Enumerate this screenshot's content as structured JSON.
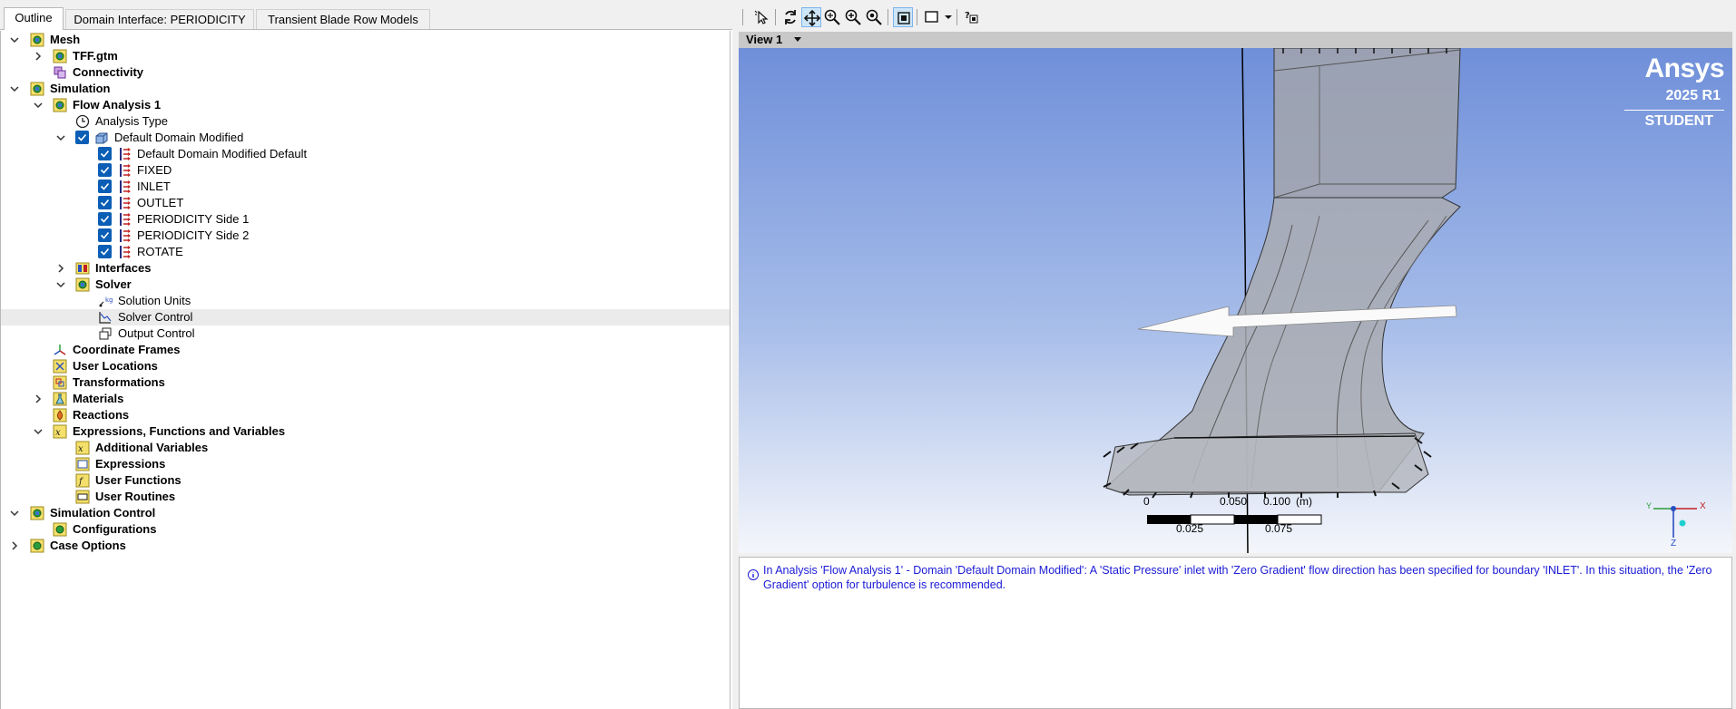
{
  "tabs": [
    {
      "label": "Outline",
      "active": true
    },
    {
      "label": "Domain Interface: PERIODICITY",
      "active": false
    },
    {
      "label": "Transient Blade Row Models",
      "active": false
    }
  ],
  "tree": {
    "mesh": "Mesh",
    "tff": "TFF.gtm",
    "connectivity": "Connectivity",
    "simulation": "Simulation",
    "flow": "Flow Analysis 1",
    "analysis_type": "Analysis Type",
    "domain": "Default Domain Modified",
    "bc": [
      "Default Domain Modified Default",
      "FIXED",
      "INLET",
      "OUTLET",
      "PERIODICITY Side 1",
      "PERIODICITY Side 2",
      "ROTATE"
    ],
    "interfaces": "Interfaces",
    "solver": "Solver",
    "solution_units": "Solution Units",
    "solver_control": "Solver Control",
    "output_control": "Output Control",
    "coord_frames": "Coordinate Frames",
    "user_locations": "User Locations",
    "transformations": "Transformations",
    "materials": "Materials",
    "reactions": "Reactions",
    "expressions_group": "Expressions, Functions and Variables",
    "additional_vars": "Additional Variables",
    "expressions": "Expressions",
    "user_functions": "User Functions",
    "user_routines": "User Routines",
    "sim_control": "Simulation Control",
    "configurations": "Configurations",
    "case_options": "Case Options"
  },
  "view": {
    "label": "View 1",
    "brand_name": "Ansys",
    "brand_version": "2025 R1",
    "brand_edition": "STUDENT",
    "scale_top": [
      "0",
      "0.050",
      "0.100",
      "(m)"
    ],
    "scale_bottom": [
      "0.025",
      "0.075"
    ],
    "axis_x": "X",
    "axis_y": "Y",
    "axis_z": "Z"
  },
  "message": "In Analysis 'Flow Analysis 1' - Domain 'Default Domain Modified': A 'Static Pressure' inlet with 'Zero Gradient' flow direction has been specified for boundary 'INLET'. In this situation, the 'Zero Gradient' option for turbulence is recommended.",
  "colors": {
    "message_text": "#1a1ad6",
    "check_blue": "#0a5eb5",
    "view_bg_top": "#6f8fd9"
  }
}
